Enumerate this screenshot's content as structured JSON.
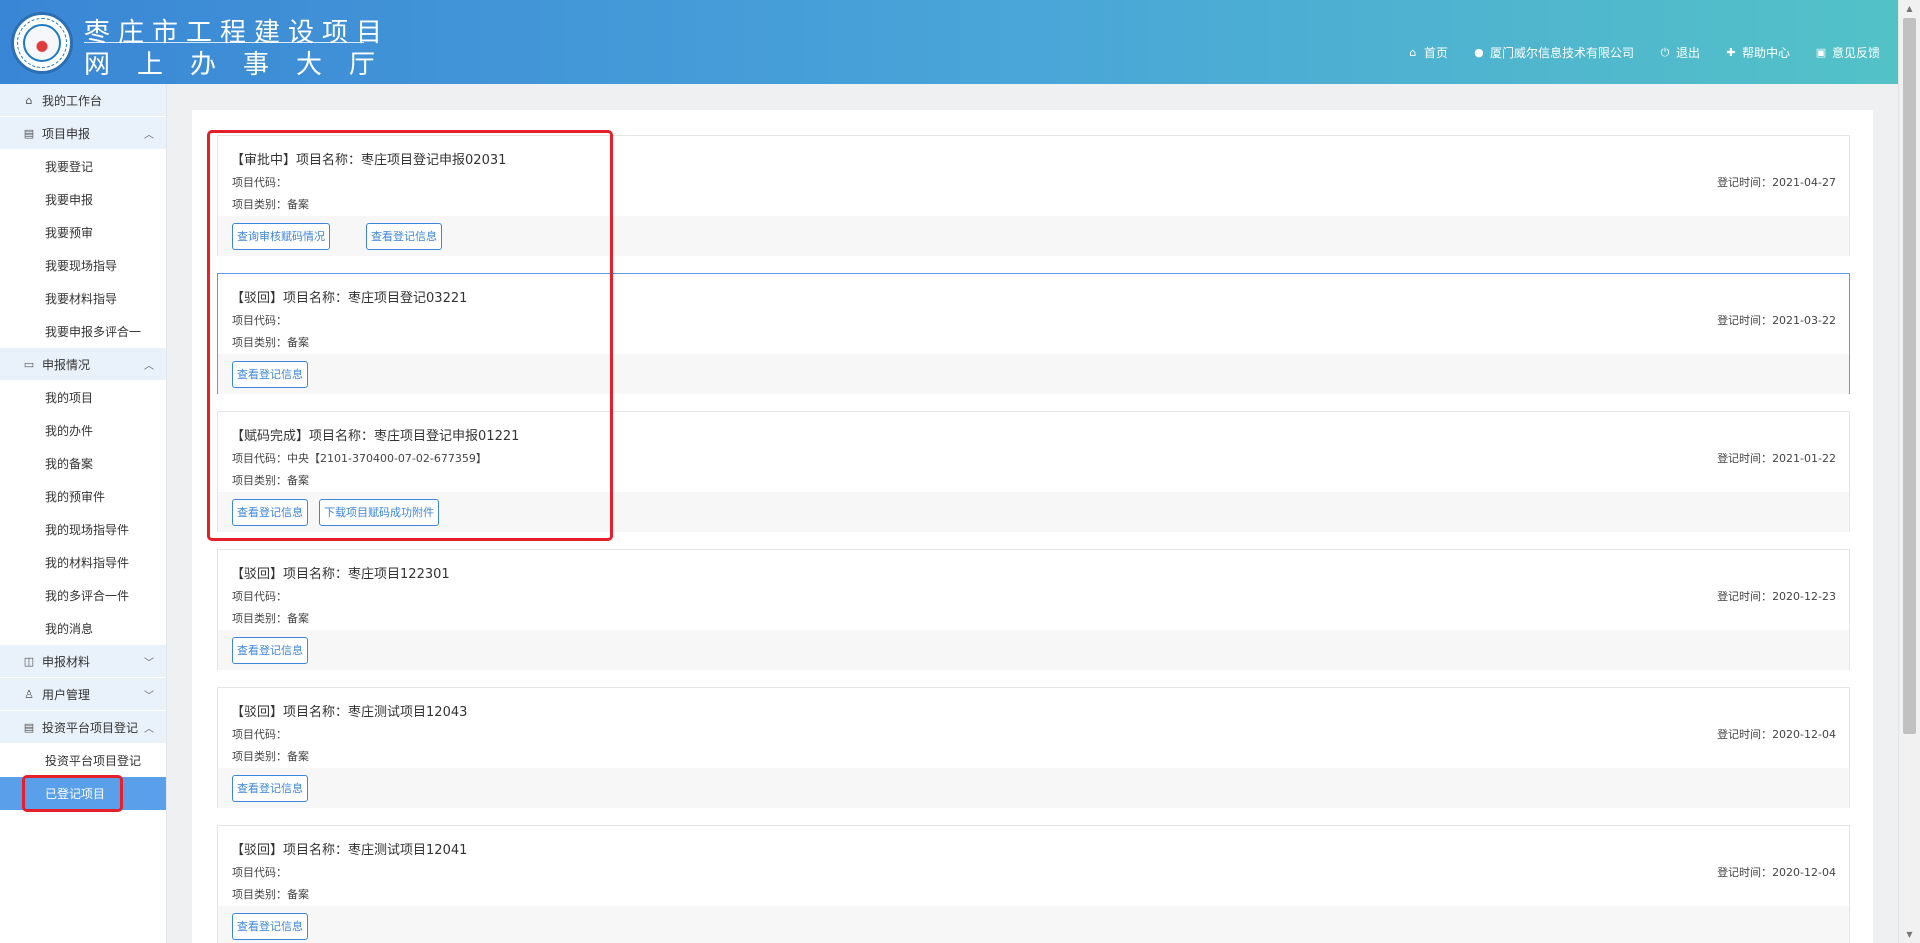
{
  "header": {
    "title_line1": "枣庄市工程建设项目",
    "title_line2": "网上办事大厅",
    "nav": [
      {
        "label": "首页",
        "icon": "home-icon"
      },
      {
        "label": "厦门威尔信息技术有限公司",
        "icon": "user-icon"
      },
      {
        "label": "退出",
        "icon": "power-icon"
      },
      {
        "label": "帮助中心",
        "icon": "help-icon"
      },
      {
        "label": "意见反馈",
        "icon": "feedback-icon"
      }
    ]
  },
  "sidebar": {
    "items": [
      {
        "label": "我的工作台",
        "icon": "home-icon",
        "level": 1
      },
      {
        "label": "项目申报",
        "icon": "document-icon",
        "level": 1,
        "expanded": true
      },
      {
        "label": "我要登记",
        "level": 2
      },
      {
        "label": "我要申报",
        "level": 2
      },
      {
        "label": "我要预审",
        "level": 2
      },
      {
        "label": "我要现场指导",
        "level": 2
      },
      {
        "label": "我要材料指导",
        "level": 2
      },
      {
        "label": "我要申报多评合一",
        "level": 2
      },
      {
        "label": "申报情况",
        "icon": "folder-icon",
        "level": 1,
        "expanded": true
      },
      {
        "label": "我的项目",
        "level": 2
      },
      {
        "label": "我的办件",
        "level": 2
      },
      {
        "label": "我的备案",
        "level": 2
      },
      {
        "label": "我的预审件",
        "level": 2
      },
      {
        "label": "我的现场指导件",
        "level": 2
      },
      {
        "label": "我的材料指导件",
        "level": 2
      },
      {
        "label": "我的多评合一件",
        "level": 2
      },
      {
        "label": "我的消息",
        "level": 2
      },
      {
        "label": "申报材料",
        "icon": "material-icon",
        "level": 1,
        "expanded": false
      },
      {
        "label": "用户管理",
        "icon": "user-icon",
        "level": 1,
        "expanded": false
      },
      {
        "label": "投资平台项目登记",
        "icon": "document-icon",
        "level": 1,
        "expanded": true
      },
      {
        "label": "投资平台项目登记",
        "level": 2
      },
      {
        "label": "已登记项目",
        "level": 2,
        "active": true
      }
    ]
  },
  "projects": [
    {
      "status": "【审批中】",
      "name_label": "项目名称：",
      "name": "枣庄项目登记申报02031",
      "code_label": "项目代码：",
      "code": "",
      "type_label": "项目类别：",
      "type": "备案",
      "time_label": "登记时间：",
      "time": "2021-04-27",
      "buttons": [
        "查询审核赋码情况",
        "查看登记信息"
      ]
    },
    {
      "status": "【驳回】",
      "name_label": "项目名称：",
      "name": "枣庄项目登记03221",
      "code_label": "项目代码：",
      "code": "",
      "type_label": "项目类别：",
      "type": "备案",
      "time_label": "登记时间：",
      "time": "2021-03-22",
      "buttons": [
        "查看登记信息"
      ]
    },
    {
      "status": "【赋码完成】",
      "name_label": "项目名称：",
      "name": "枣庄项目登记申报01221",
      "code_label": "项目代码：",
      "code": "中央【2101-370400-07-02-677359】",
      "type_label": "项目类别：",
      "type": "备案",
      "time_label": "登记时间：",
      "time": "2021-01-22",
      "buttons": [
        "查看登记信息",
        "下载项目赋码成功附件"
      ]
    },
    {
      "status": "【驳回】",
      "name_label": "项目名称：",
      "name": "枣庄项目122301",
      "code_label": "项目代码：",
      "code": "",
      "type_label": "项目类别：",
      "type": "备案",
      "time_label": "登记时间：",
      "time": "2020-12-23",
      "buttons": [
        "查看登记信息"
      ]
    },
    {
      "status": "【驳回】",
      "name_label": "项目名称：",
      "name": "枣庄测试项目12043",
      "code_label": "项目代码：",
      "code": "",
      "type_label": "项目类别：",
      "type": "备案",
      "time_label": "登记时间：",
      "time": "2020-12-04",
      "buttons": [
        "查看登记信息"
      ]
    },
    {
      "status": "【驳回】",
      "name_label": "项目名称：",
      "name": "枣庄测试项目12041",
      "code_label": "项目代码：",
      "code": "",
      "type_label": "项目类别：",
      "type": "备案",
      "time_label": "登记时间：",
      "time": "2020-12-04",
      "buttons": [
        "查看登记信息"
      ]
    }
  ],
  "colors": {
    "header_start": "#3a86d6",
    "header_end": "#53c2c7",
    "accent": "#3d86d8",
    "active_menu": "#5a9fea",
    "highlight_red": "#e5202a"
  }
}
